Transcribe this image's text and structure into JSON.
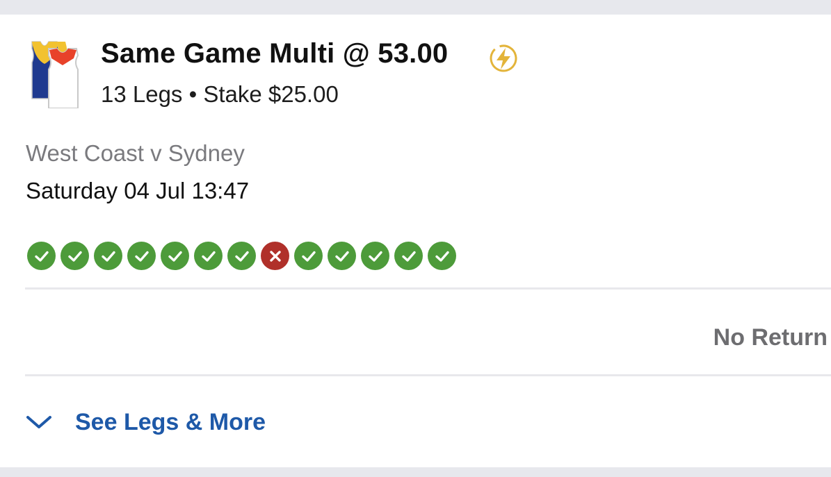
{
  "bet": {
    "title": "Same Game Multi @ 53.00",
    "summary": "13 Legs • Stake $25.00",
    "boost_icon": "lightning-bolt-icon",
    "team_icon": "team-jerseys-icon"
  },
  "event": {
    "match": "West Coast v Sydney",
    "datetime": "Saturday 04 Jul 13:47"
  },
  "legs": [
    {
      "status": "won",
      "icon": "check-icon"
    },
    {
      "status": "won",
      "icon": "check-icon"
    },
    {
      "status": "won",
      "icon": "check-icon"
    },
    {
      "status": "won",
      "icon": "check-icon"
    },
    {
      "status": "won",
      "icon": "check-icon"
    },
    {
      "status": "won",
      "icon": "check-icon"
    },
    {
      "status": "won",
      "icon": "check-icon"
    },
    {
      "status": "lost",
      "icon": "cross-icon"
    },
    {
      "status": "won",
      "icon": "check-icon"
    },
    {
      "status": "won",
      "icon": "check-icon"
    },
    {
      "status": "won",
      "icon": "check-icon"
    },
    {
      "status": "won",
      "icon": "check-icon"
    },
    {
      "status": "won",
      "icon": "check-icon"
    }
  ],
  "result": {
    "return_label": "No Return"
  },
  "footer": {
    "see_more_label": "See Legs & More",
    "chevron_icon": "chevron-down-icon"
  },
  "colors": {
    "won": "#4d9b3a",
    "lost": "#b0302a",
    "link": "#1e59a8",
    "boost": "#e3b43a"
  }
}
